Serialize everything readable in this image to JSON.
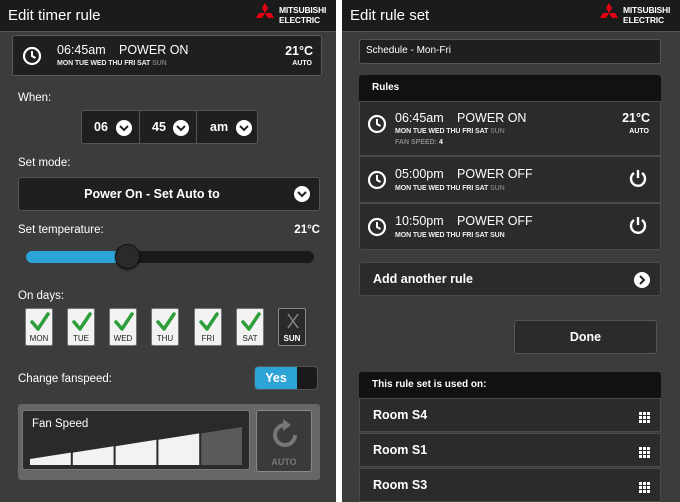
{
  "brand": {
    "line1": "MITSUBISHI",
    "line2": "ELECTRIC",
    "color": "#e60012"
  },
  "left": {
    "title": "Edit timer rule",
    "summary": {
      "time": "06:45am",
      "mode": "POWER ON",
      "days_on": "MON TUE WED THU FRI SAT",
      "days_off": "SUN",
      "temp": "21°C",
      "fan": "AUTO"
    },
    "when_label": "When:",
    "hour": "06",
    "minute": "45",
    "ampm": "am",
    "mode_label": "Set mode:",
    "mode_value": "Power On - Set Auto to",
    "temp_label": "Set temperature:",
    "temp_value": "21°C",
    "temp_slider_fraction": 0.35,
    "days_label": "On days:",
    "days": [
      {
        "label": "MON",
        "checked": true
      },
      {
        "label": "TUE",
        "checked": true
      },
      {
        "label": "WED",
        "checked": true
      },
      {
        "label": "THU",
        "checked": true
      },
      {
        "label": "FRI",
        "checked": true
      },
      {
        "label": "SAT",
        "checked": true
      },
      {
        "label": "SUN",
        "checked": false
      }
    ],
    "fanspeed_label": "Change fanspeed:",
    "fanspeed_toggle": "Yes",
    "fan_speed_label": "Fan Speed",
    "fan_speed_level": 4,
    "fan_speed_levels": 5,
    "auto_label": "AUTO"
  },
  "right": {
    "title": "Edit rule set",
    "schedule_name": "Schedule - Mon-Fri",
    "rules_header": "Rules",
    "rules": [
      {
        "time": "06:45am",
        "mode": "POWER ON",
        "days_on": "MON TUE WED THU FRI SAT",
        "days_off": "SUN",
        "fan_label": "FAN SPEED:",
        "fan_value": "4",
        "temp": "21°C",
        "sub": "AUTO"
      },
      {
        "time": "05:00pm",
        "mode": "POWER OFF",
        "days_on": "MON TUE WED THU FRI SAT",
        "days_off": "SUN"
      },
      {
        "time": "10:50pm",
        "mode": "POWER OFF",
        "days_on": "MON TUE WED THU FRI SAT SUN",
        "days_off": ""
      }
    ],
    "add_rule": "Add another rule",
    "done": "Done",
    "used_header": "This rule set is used on:",
    "rooms": [
      "Room S4",
      "Room S1",
      "Room S3"
    ]
  }
}
